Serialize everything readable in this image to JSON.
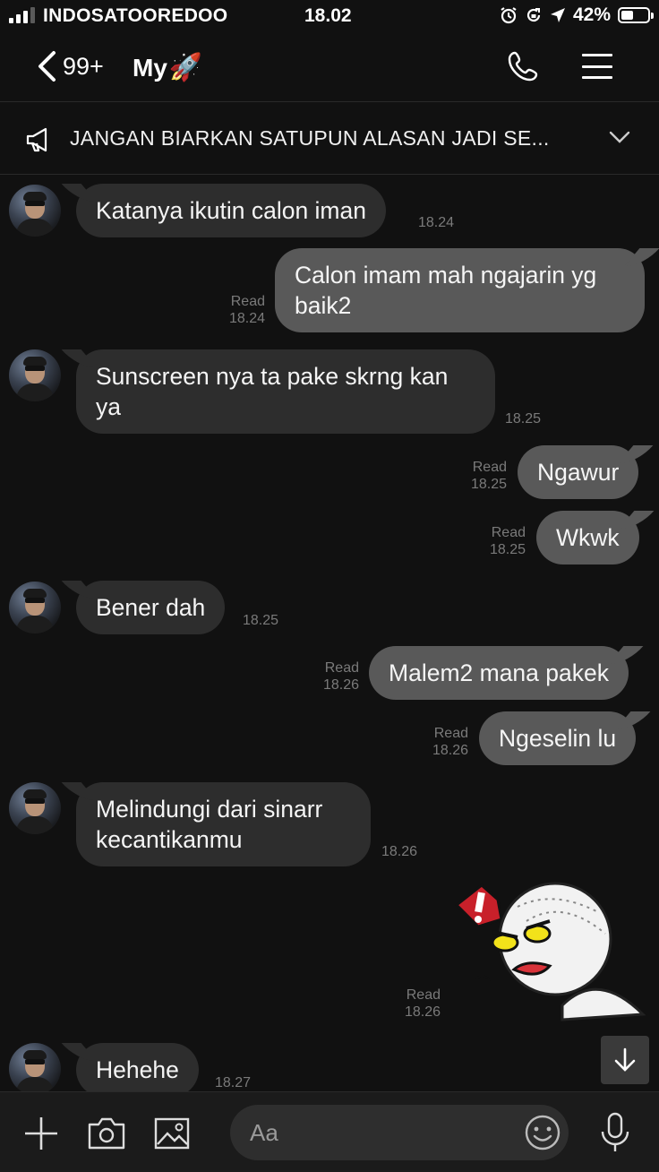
{
  "status_bar": {
    "carrier": "INDOSATOOREDOO",
    "time": "18.02",
    "battery_percent": "42%",
    "icons": [
      "signal-icon",
      "alarm-icon",
      "rotation-lock-icon",
      "location-arrow-icon",
      "battery-icon"
    ]
  },
  "header": {
    "unread_count": "99+",
    "chat_name": "My",
    "chat_name_emoji": "🚀",
    "icons": [
      "back-chevron-icon",
      "phone-icon",
      "menu-icon"
    ]
  },
  "announcement": {
    "text": "JANGAN BIARKAN SATUPUN ALASAN JADI SE..."
  },
  "messages": [
    {
      "direction": "in",
      "text": "Katanya ikutin calon iman",
      "time": "18.24"
    },
    {
      "direction": "out",
      "text": "Calon imam mah ngajarin yg baik2",
      "read": "Read",
      "time": "18.24"
    },
    {
      "direction": "in",
      "text": "Sunscreen nya ta pake skrng kan ya",
      "time": "18.25"
    },
    {
      "direction": "out",
      "text": "Ngawur",
      "read": "Read",
      "time": "18.25"
    },
    {
      "direction": "out",
      "text": "Wkwk",
      "read": "Read",
      "time": "18.25"
    },
    {
      "direction": "in",
      "text": "Bener dah",
      "time": "18.25"
    },
    {
      "direction": "out",
      "text": "Malem2 mana pakek",
      "read": "Read",
      "time": "18.26"
    },
    {
      "direction": "out",
      "text": "Ngeselin lu",
      "read": "Read",
      "time": "18.26"
    },
    {
      "direction": "in",
      "text": "Melindungi dari sinarr kecantikanmu",
      "time": "18.26"
    },
    {
      "direction": "out",
      "sticker": "angry-round-face-sticker",
      "read": "Read",
      "time": "18.26"
    },
    {
      "direction": "in",
      "text": "Hehehe",
      "time": "18.27"
    }
  ],
  "input_bar": {
    "placeholder": "Aa",
    "icons": [
      "plus-icon",
      "camera-icon",
      "image-icon",
      "emoji-icon",
      "microphone-icon"
    ]
  },
  "colors": {
    "background": "#111111",
    "incoming_bubble": "#2d2d2d",
    "outgoing_bubble": "#595959",
    "meta_text": "#7a7a7a"
  }
}
